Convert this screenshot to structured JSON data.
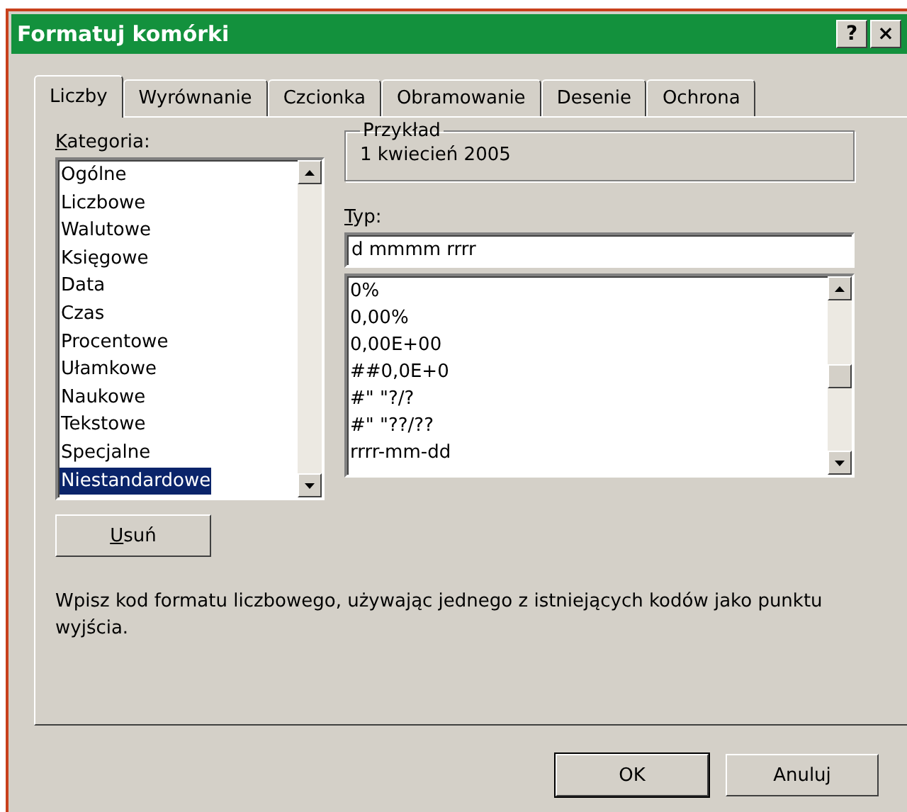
{
  "window": {
    "title": "Formatuj komórki",
    "help_button": "?",
    "close_button": "×"
  },
  "tabs": [
    {
      "label": "Liczby",
      "selected": true
    },
    {
      "label": "Wyrównanie",
      "selected": false
    },
    {
      "label": "Czcionka",
      "selected": false
    },
    {
      "label": "Obramowanie",
      "selected": false
    },
    {
      "label": "Desenie",
      "selected": false
    },
    {
      "label": "Ochrona",
      "selected": false
    }
  ],
  "category": {
    "label": "Kategoria:",
    "items": [
      {
        "label": "Ogólne",
        "selected": false
      },
      {
        "label": "Liczbowe",
        "selected": false
      },
      {
        "label": "Walutowe",
        "selected": false
      },
      {
        "label": "Księgowe",
        "selected": false
      },
      {
        "label": "Data",
        "selected": false
      },
      {
        "label": "Czas",
        "selected": false
      },
      {
        "label": "Procentowe",
        "selected": false
      },
      {
        "label": "Ułamkowe",
        "selected": false
      },
      {
        "label": "Naukowe",
        "selected": false
      },
      {
        "label": "Tekstowe",
        "selected": false
      },
      {
        "label": "Specjalne",
        "selected": false
      },
      {
        "label": "Niestandardowe",
        "selected": true
      }
    ]
  },
  "sample": {
    "label": "Przykład",
    "value": "1 kwiecień 2005"
  },
  "type": {
    "label": "Typ:",
    "value": "d mmmm rrrr",
    "items": [
      {
        "label": "0%",
        "selected": false
      },
      {
        "label": "0,00%",
        "selected": false
      },
      {
        "label": "0,00E+00",
        "selected": false
      },
      {
        "label": "##0,0E+0",
        "selected": false
      },
      {
        "label": "#\" \"?/?",
        "selected": false
      },
      {
        "label": "#\" \"??/??",
        "selected": false
      },
      {
        "label": "rrrr-mm-dd",
        "selected": false
      }
    ]
  },
  "delete_button": "Usuń",
  "description": "Wpisz kod formatu liczbowego, używając jednego z istniejących kodów jako punktu wyjścia.",
  "buttons": [
    {
      "label": "OK",
      "default": true
    },
    {
      "label": "Anuluj",
      "default": false
    }
  ]
}
